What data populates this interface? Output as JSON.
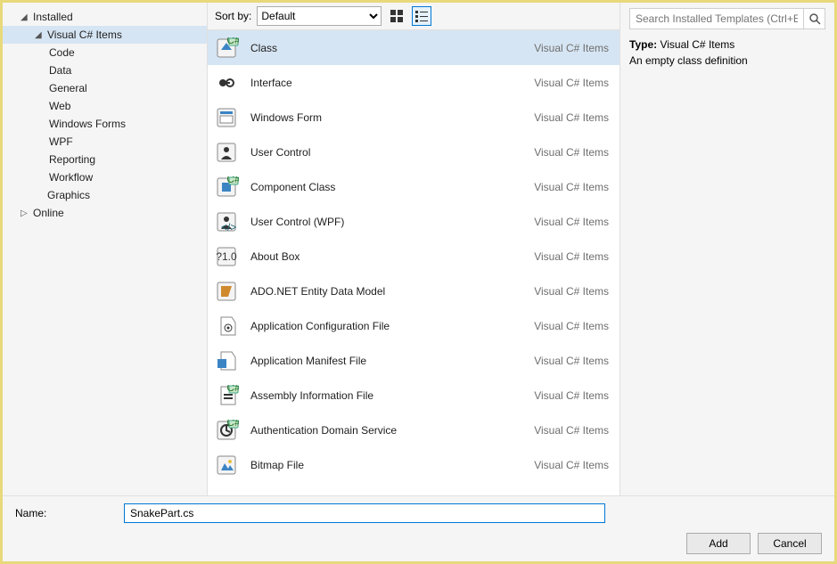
{
  "left_tree": {
    "root": {
      "label": "Installed",
      "expanded": true
    },
    "csharp": {
      "label": "Visual C# Items",
      "expanded": true,
      "selected": true
    },
    "children": [
      {
        "label": "Code"
      },
      {
        "label": "Data"
      },
      {
        "label": "General"
      },
      {
        "label": "Web"
      },
      {
        "label": "Windows Forms"
      },
      {
        "label": "WPF"
      },
      {
        "label": "Reporting"
      },
      {
        "label": "Workflow"
      }
    ],
    "graphics": {
      "label": "Graphics"
    },
    "online": {
      "label": "Online",
      "expanded": false
    }
  },
  "sortbar": {
    "label": "Sort by:",
    "selected": "Default",
    "options": [
      "Default"
    ]
  },
  "templates": [
    {
      "name": "Class",
      "type": "Visual C# Items",
      "icon": "class-icon",
      "selected": true
    },
    {
      "name": "Interface",
      "type": "Visual C# Items",
      "icon": "interface-icon"
    },
    {
      "name": "Windows Form",
      "type": "Visual C# Items",
      "icon": "form-icon"
    },
    {
      "name": "User Control",
      "type": "Visual C# Items",
      "icon": "usercontrol-icon"
    },
    {
      "name": "Component Class",
      "type": "Visual C# Items",
      "icon": "component-icon"
    },
    {
      "name": "User Control (WPF)",
      "type": "Visual C# Items",
      "icon": "usercontrol-wpf-icon"
    },
    {
      "name": "About Box",
      "type": "Visual C# Items",
      "icon": "aboutbox-icon"
    },
    {
      "name": "ADO.NET Entity Data Model",
      "type": "Visual C# Items",
      "icon": "ado-icon"
    },
    {
      "name": "Application Configuration File",
      "type": "Visual C# Items",
      "icon": "appconfig-icon"
    },
    {
      "name": "Application Manifest File",
      "type": "Visual C# Items",
      "icon": "manifest-icon"
    },
    {
      "name": "Assembly Information File",
      "type": "Visual C# Items",
      "icon": "assemblyinfo-icon"
    },
    {
      "name": "Authentication Domain Service",
      "type": "Visual C# Items",
      "icon": "authservice-icon"
    },
    {
      "name": "Bitmap File",
      "type": "Visual C# Items",
      "icon": "bitmap-icon"
    }
  ],
  "search_placeholder": "Search Installed Templates (Ctrl+E)",
  "details": {
    "type_label": "Type:",
    "type_value": "Visual C# Items",
    "description": "An empty class definition"
  },
  "name_field": {
    "label": "Name:",
    "value": "SnakePart.cs"
  },
  "buttons": {
    "add": "Add",
    "cancel": "Cancel"
  }
}
